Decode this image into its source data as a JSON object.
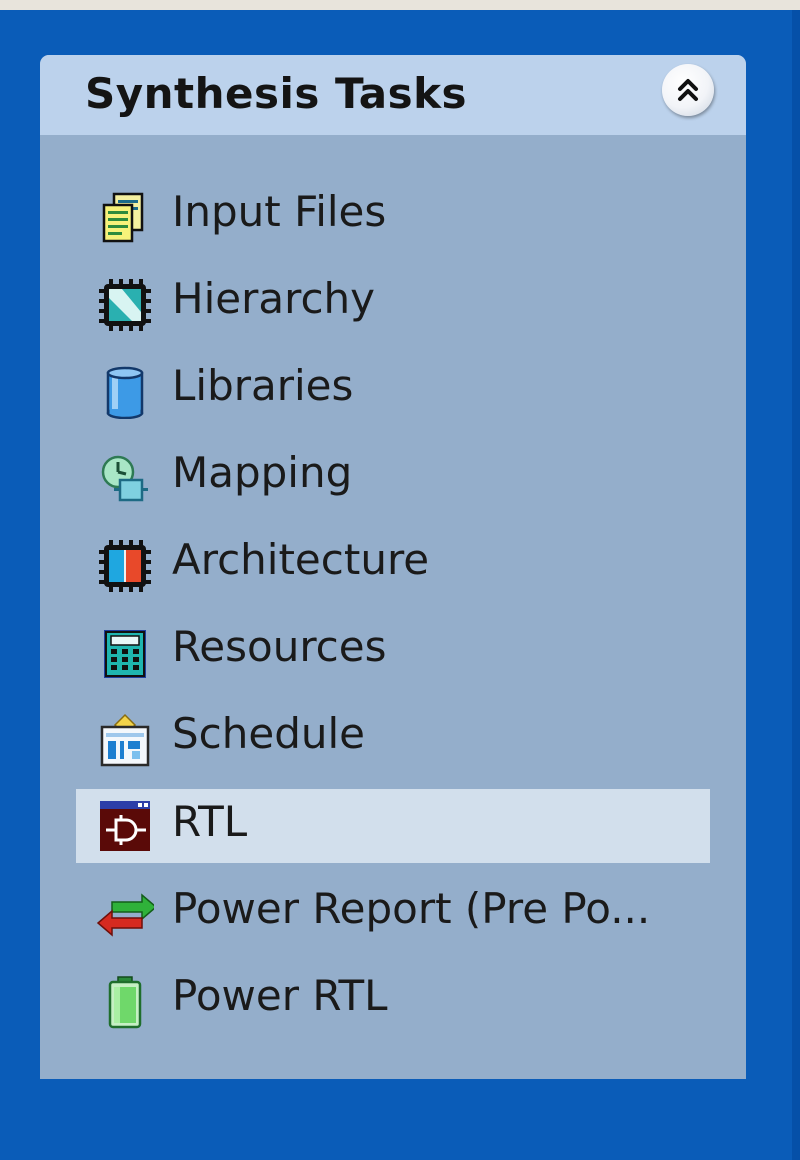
{
  "panel": {
    "title": "Synthesis Tasks",
    "collapse_icon": "double-chevron-up-icon",
    "items": [
      {
        "label": "Input Files",
        "icon": "input-files-icon"
      },
      {
        "label": "Hierarchy",
        "icon": "hierarchy-icon"
      },
      {
        "label": "Libraries",
        "icon": "libraries-icon"
      },
      {
        "label": "Mapping",
        "icon": "mapping-icon"
      },
      {
        "label": "Architecture",
        "icon": "architecture-icon"
      },
      {
        "label": "Resources",
        "icon": "resources-icon"
      },
      {
        "label": "Schedule",
        "icon": "schedule-icon"
      },
      {
        "label": "RTL",
        "icon": "rtl-icon",
        "selected": true
      },
      {
        "label": "Power Report (Pre Po...",
        "icon": "power-report-icon"
      },
      {
        "label": "Power RTL",
        "icon": "power-rtl-icon"
      }
    ]
  },
  "colors": {
    "background": "#0a5cb8",
    "panel": "#94aecb",
    "header": "#bcd2ec",
    "selected": "#d2dfec"
  }
}
